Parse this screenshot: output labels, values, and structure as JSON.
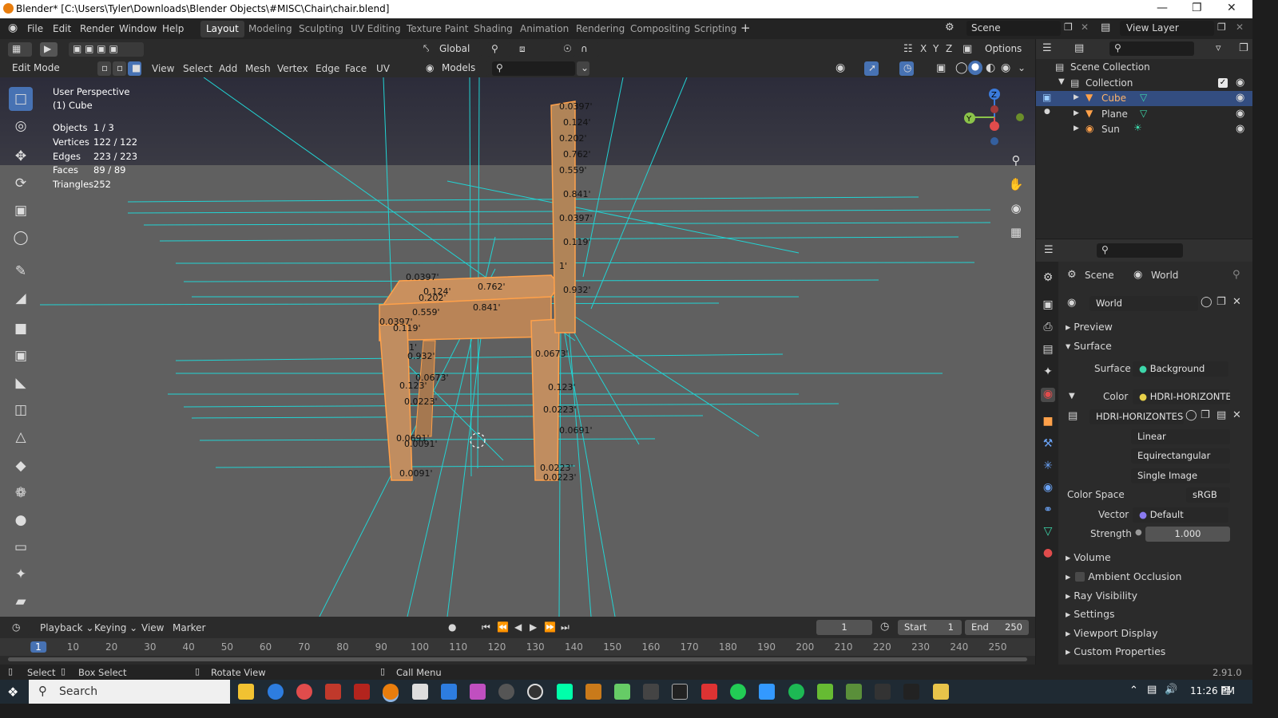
{
  "title_bar": {
    "title": "Blender* [C:\\Users\\Tyler\\Downloads\\Blender Objects\\#MISC\\Chair\\chair.blend]"
  },
  "menu": {
    "file": "File",
    "edit": "Edit",
    "render": "Render",
    "window": "Window",
    "help": "Help"
  },
  "workspaces": [
    "Layout",
    "Modeling",
    "Sculpting",
    "UV Editing",
    "Texture Paint",
    "Shading",
    "Animation",
    "Rendering",
    "Compositing",
    "Scripting"
  ],
  "active_workspace": "Layout",
  "scene_selector": "Scene",
  "view_layer_selector": "View Layer",
  "viewport_header": {
    "orientation": "Global",
    "options": "Options",
    "mode": "Edit Mode",
    "menus": [
      "View",
      "Select",
      "Add",
      "Mesh",
      "Vertex",
      "Edge",
      "Face",
      "UV"
    ],
    "axis_x": "X",
    "axis_y": "Y",
    "axis_z": "Z",
    "models_dropdown": "Models"
  },
  "overlay_stats": {
    "perspective": "User Perspective",
    "object": "(1) Cube",
    "objects_label": "Objects",
    "objects_value": "1 / 3",
    "vertices_label": "Vertices",
    "vertices_value": "122 / 122",
    "edges_label": "Edges",
    "edges_value": "223 / 223",
    "faces_label": "Faces",
    "faces_value": "89 / 89",
    "triangles_label": "Triangles",
    "triangles_value": "252"
  },
  "edge_measurements": [
    "0.0397'",
    "0.124'",
    "0.202'",
    "0.762'",
    "0.559'",
    "0.841'",
    "0.0397'",
    "0.119'",
    "1'",
    "0.932'",
    "0.0673'",
    "0.123'",
    "0.0223'",
    "0.0691'",
    "0.0091'",
    "0.0223'"
  ],
  "nav_gizmo": {
    "x": "X",
    "y": "Y",
    "z": "Z"
  },
  "outliner": {
    "scene_collection": "Scene Collection",
    "collection": "Collection",
    "items": [
      {
        "label": "Cube",
        "selected": true
      },
      {
        "label": "Plane",
        "selected": false
      },
      {
        "label": "Sun",
        "selected": false
      }
    ]
  },
  "properties": {
    "breadcrumb_scene": "Scene",
    "breadcrumb_world": "World",
    "world_name": "World",
    "preview": "Preview",
    "surface_section": "Surface",
    "surface_label": "Surface",
    "surface_value": "Background",
    "color_label": "Color",
    "color_value": "HDRI-HORIZONTES-...",
    "image_name": "HDRI-HORIZONTES-...",
    "interpolation": "Linear",
    "projection": "Equirectangular",
    "source": "Single Image",
    "color_space_label": "Color Space",
    "color_space_value": "sRGB",
    "vector_label": "Vector",
    "vector_value": "Default",
    "strength_label": "Strength",
    "strength_value": "1.000",
    "sections": [
      "Volume",
      "Ambient Occlusion",
      "Ray Visibility",
      "Settings",
      "Viewport Display",
      "Custom Properties"
    ]
  },
  "timeline": {
    "playback": "Playback",
    "keying": "Keying",
    "view": "View",
    "marker": "Marker",
    "current_frame": "1",
    "start_label": "Start",
    "start_value": "1",
    "end_label": "End",
    "end_value": "250",
    "ruler": [
      "1",
      "10",
      "20",
      "30",
      "40",
      "50",
      "60",
      "70",
      "80",
      "90",
      "100",
      "110",
      "120",
      "130",
      "140",
      "150",
      "160",
      "170",
      "180",
      "190",
      "200",
      "210",
      "220",
      "230",
      "240",
      "250"
    ]
  },
  "status_bar": {
    "select": "Select",
    "box_select": "Box Select",
    "rotate_view": "Rotate View",
    "call_menu": "Call Menu",
    "version": "2.91.0"
  },
  "taskbar": {
    "search": "Search",
    "time": "11:26 PM"
  },
  "colors": {
    "accent": "#4772b3",
    "mesh_orange": "#ffa14a",
    "guide_cyan": "#00d8d8"
  }
}
